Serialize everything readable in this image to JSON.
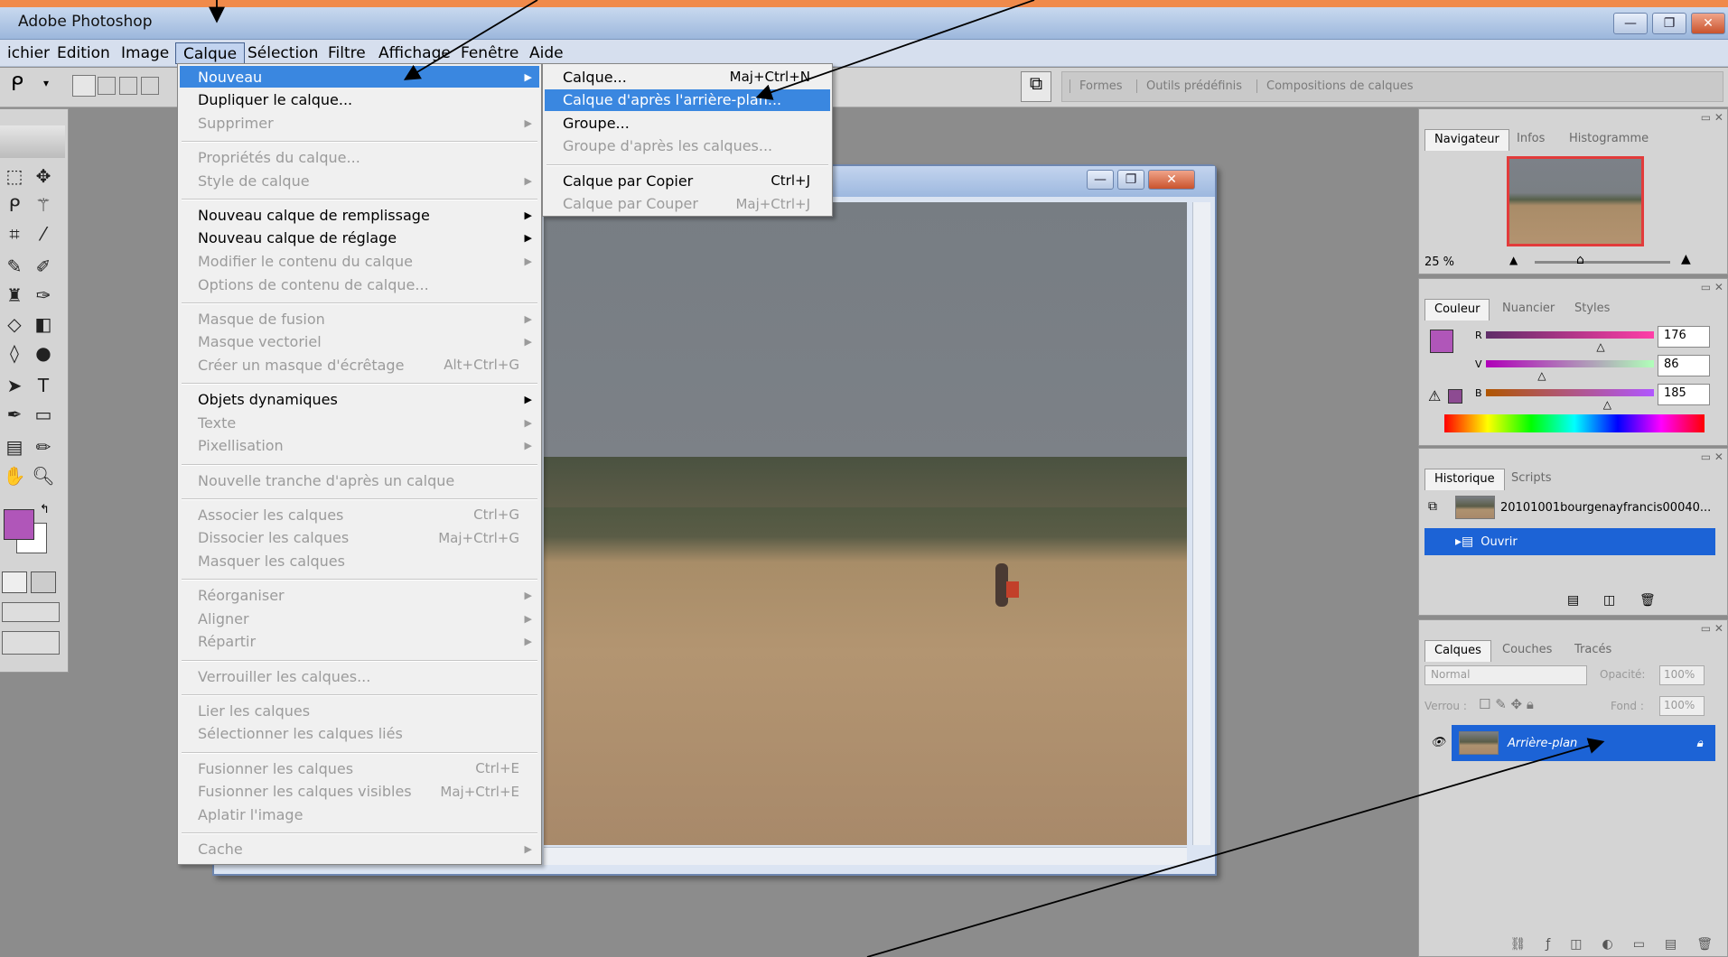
{
  "app": {
    "title": "Adobe Photoshop"
  },
  "window_controls": {
    "minimize": "—",
    "restore": "❐",
    "close": "✕"
  },
  "menubar": {
    "items": [
      {
        "label": "ichier"
      },
      {
        "label": "Edition"
      },
      {
        "label": "Image"
      },
      {
        "label": "Calque",
        "active": true
      },
      {
        "label": "Sélection"
      },
      {
        "label": "Filtre"
      },
      {
        "label": "Affichage"
      },
      {
        "label": "Fenêtre"
      },
      {
        "label": "Aide"
      }
    ]
  },
  "palette_well": {
    "tabs": [
      "Formes",
      "Outils prédéfinis",
      "Compositions de calques"
    ]
  },
  "calque_menu": {
    "items": [
      {
        "label": "Nouveau",
        "highlighted": true,
        "submenu": true
      },
      {
        "label": "Dupliquer le calque..."
      },
      {
        "label": "Supprimer",
        "disabled": true,
        "submenu": true
      },
      {
        "separator": true
      },
      {
        "label": "Propriétés du calque...",
        "disabled": true
      },
      {
        "label": "Style de calque",
        "disabled": true,
        "submenu": true
      },
      {
        "separator": true
      },
      {
        "label": "Nouveau calque de remplissage",
        "submenu": true
      },
      {
        "label": "Nouveau calque de réglage",
        "submenu": true
      },
      {
        "label": "Modifier le contenu du calque",
        "disabled": true,
        "submenu": true
      },
      {
        "label": "Options de contenu de calque...",
        "disabled": true
      },
      {
        "separator": true
      },
      {
        "label": "Masque de fusion",
        "disabled": true,
        "submenu": true
      },
      {
        "label": "Masque vectoriel",
        "disabled": true,
        "submenu": true
      },
      {
        "label": "Créer un masque d'écrêtage",
        "disabled": true,
        "shortcut": "Alt+Ctrl+G"
      },
      {
        "separator": true
      },
      {
        "label": "Objets dynamiques",
        "submenu": true
      },
      {
        "label": "Texte",
        "disabled": true,
        "submenu": true
      },
      {
        "label": "Pixellisation",
        "disabled": true,
        "submenu": true
      },
      {
        "separator": true
      },
      {
        "label": "Nouvelle tranche d'après un calque",
        "disabled": true
      },
      {
        "separator": true
      },
      {
        "label": "Associer les calques",
        "disabled": true,
        "shortcut": "Ctrl+G"
      },
      {
        "label": "Dissocier les calques",
        "disabled": true,
        "shortcut": "Maj+Ctrl+G"
      },
      {
        "label": "Masquer les calques",
        "disabled": true
      },
      {
        "separator": true
      },
      {
        "label": "Réorganiser",
        "disabled": true,
        "submenu": true
      },
      {
        "label": "Aligner",
        "disabled": true,
        "submenu": true
      },
      {
        "label": "Répartir",
        "disabled": true,
        "submenu": true
      },
      {
        "separator": true
      },
      {
        "label": "Verrouiller les calques...",
        "disabled": true
      },
      {
        "separator": true
      },
      {
        "label": "Lier les calques",
        "disabled": true
      },
      {
        "label": "Sélectionner les calques liés",
        "disabled": true
      },
      {
        "separator": true
      },
      {
        "label": "Fusionner les calques",
        "disabled": true,
        "shortcut": "Ctrl+E"
      },
      {
        "label": "Fusionner les calques visibles",
        "disabled": true,
        "shortcut": "Maj+Ctrl+E"
      },
      {
        "label": "Aplatir l'image",
        "disabled": true
      },
      {
        "separator": true
      },
      {
        "label": "Cache",
        "disabled": true,
        "submenu": true
      }
    ]
  },
  "nouveau_submenu": {
    "items": [
      {
        "label": "Calque...",
        "shortcut": "Maj+Ctrl+N"
      },
      {
        "label": "Calque d'après l'arrière-plan...",
        "highlighted": true
      },
      {
        "label": "Groupe..."
      },
      {
        "label": "Groupe d'après les calques...",
        "disabled": true
      },
      {
        "separator": true
      },
      {
        "label": "Calque par Copier",
        "shortcut": "Ctrl+J"
      },
      {
        "label": "Calque par Couper",
        "disabled": true,
        "shortcut": "Maj+Ctrl+J"
      }
    ]
  },
  "navigator_panel": {
    "tabs": [
      "Navigateur",
      "Infos",
      "Histogramme"
    ],
    "zoom": "25 %"
  },
  "color_panel": {
    "tabs": [
      "Couleur",
      "Nuancier",
      "Styles"
    ],
    "channels": [
      {
        "label": "R",
        "value": "176",
        "level": 0.69
      },
      {
        "label": "V",
        "value": "86",
        "level": 0.34
      },
      {
        "label": "B",
        "value": "185",
        "level": 0.73
      }
    ],
    "foreground_color": "#b056b9"
  },
  "history_panel": {
    "tabs": [
      "Historique",
      "Scripts"
    ],
    "snapshot_name": "20101001bourgenayfrancis00040...",
    "state": "Ouvrir"
  },
  "layers_panel": {
    "tabs": [
      "Calques",
      "Couches",
      "Tracés"
    ],
    "blend_mode": "Normal",
    "opacity_label": "Opacité:",
    "opacity_value": "100%",
    "lock_label": "Verrou :",
    "fill_label": "Fond :",
    "fill_value": "100%",
    "layer_name": "Arrière-plan"
  }
}
